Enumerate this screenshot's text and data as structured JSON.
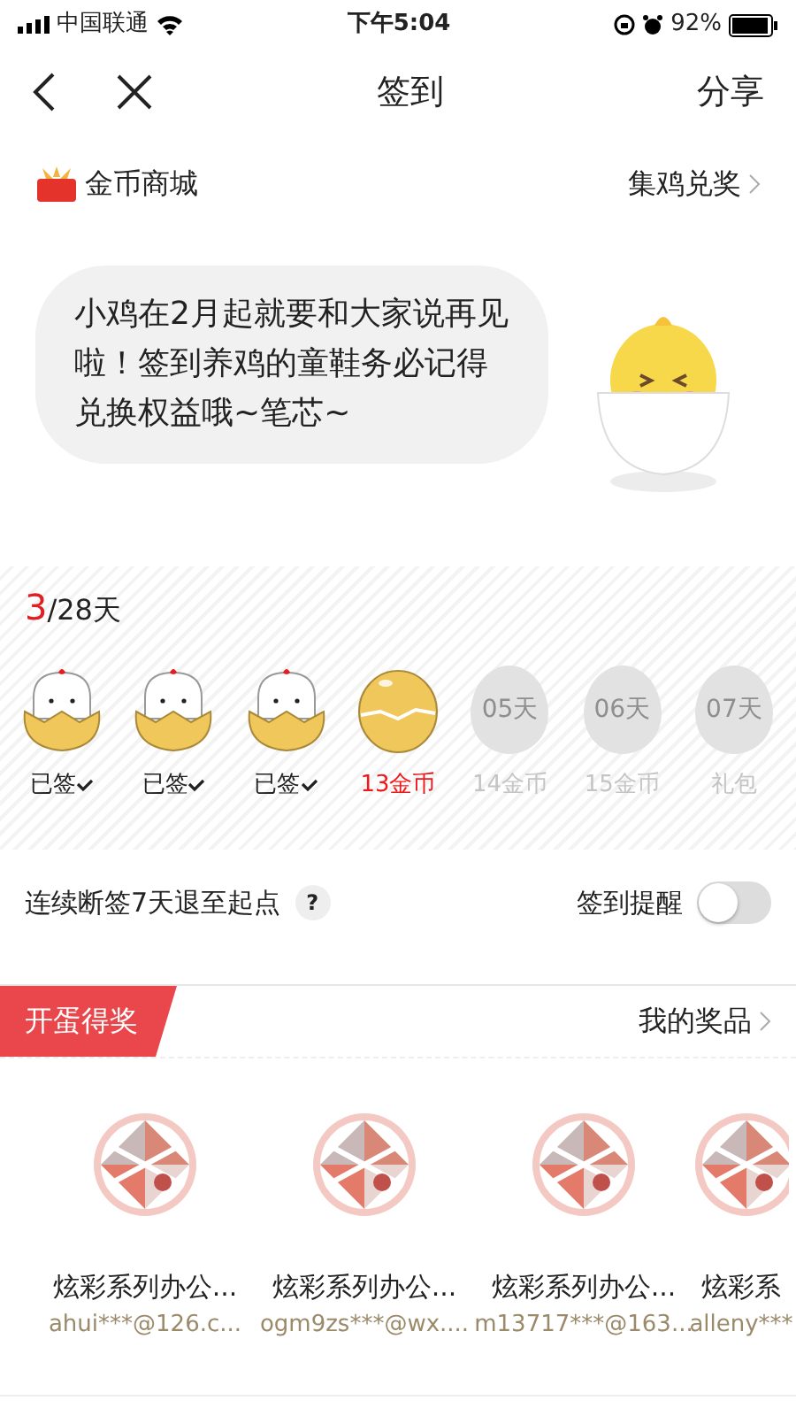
{
  "status_bar": {
    "carrier": "中国联通",
    "time": "下午5:04",
    "battery": "92%"
  },
  "nav": {
    "title": "签到",
    "action": "分享"
  },
  "mall": {
    "label": "金币商城",
    "link": "集鸡兑奖"
  },
  "bubble": {
    "text": "小鸡在2月起就要和大家说再见啦！签到养鸡的童鞋务必记得兑换权益哦~笔芯~"
  },
  "progress": {
    "current": "3",
    "total": "/28天"
  },
  "days": [
    {
      "kind": "signed",
      "label": "已签"
    },
    {
      "kind": "signed",
      "label": "已签"
    },
    {
      "kind": "signed",
      "label": "已签"
    },
    {
      "kind": "today",
      "label": "13金币"
    },
    {
      "kind": "future",
      "egg_text": "05天",
      "label": "14金币"
    },
    {
      "kind": "future",
      "egg_text": "06天",
      "label": "15金币"
    },
    {
      "kind": "future",
      "egg_text": "07天",
      "label": "礼包"
    }
  ],
  "rule": {
    "text": "连续断签7天退至起点",
    "help": "?"
  },
  "reminder": {
    "label": "签到提醒",
    "on": false
  },
  "prize_section": {
    "tag": "开蛋得奖",
    "link": "我的奖品"
  },
  "prizes": [
    {
      "kind": "picture",
      "name": "炫彩系列办公...",
      "user": "ahui***@126.c..."
    },
    {
      "kind": "picture",
      "name": "炫彩系列办公...",
      "user": "ogm9zs***@wx...."
    },
    {
      "kind": "picture",
      "name": "炫彩系列办公...",
      "user": "m13717***@163..."
    },
    {
      "kind": "picture",
      "name": "炫彩系",
      "user": "alleny***"
    }
  ]
}
